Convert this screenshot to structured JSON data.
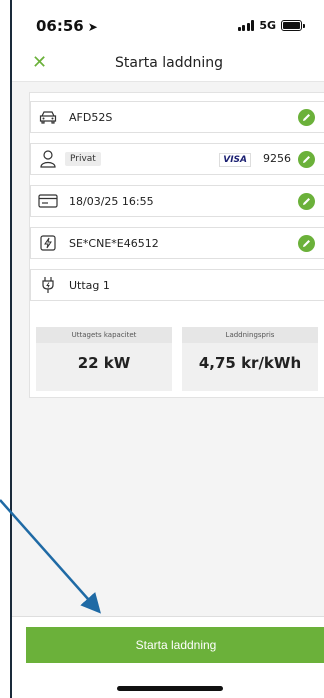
{
  "status_bar": {
    "time": "06:56",
    "network": "5G"
  },
  "nav": {
    "title": "Starta laddning"
  },
  "details": {
    "vehicle_plate": "AFD52S",
    "account_type": "Privat",
    "card_brand": "VISA",
    "card_last4": "9256",
    "datetime": "18/03/25 16:55",
    "card_id": "SE*CNE*E46512",
    "outlet": "Uttag 1"
  },
  "kpis": {
    "capacity_label": "Uttagets kapacitet",
    "capacity_value": "22 kW",
    "price_label": "Laddningspris",
    "price_value": "4,75 kr/kWh"
  },
  "cta": {
    "label": "Starta laddning"
  },
  "colors": {
    "accent": "#6bb13a",
    "annotation_arrow": "#1f6aa5"
  },
  "icons": [
    "location-arrow-icon",
    "close-icon",
    "car-icon",
    "user-icon",
    "pencil-icon",
    "card-icon",
    "charge-tag-icon",
    "plug-icon"
  ]
}
